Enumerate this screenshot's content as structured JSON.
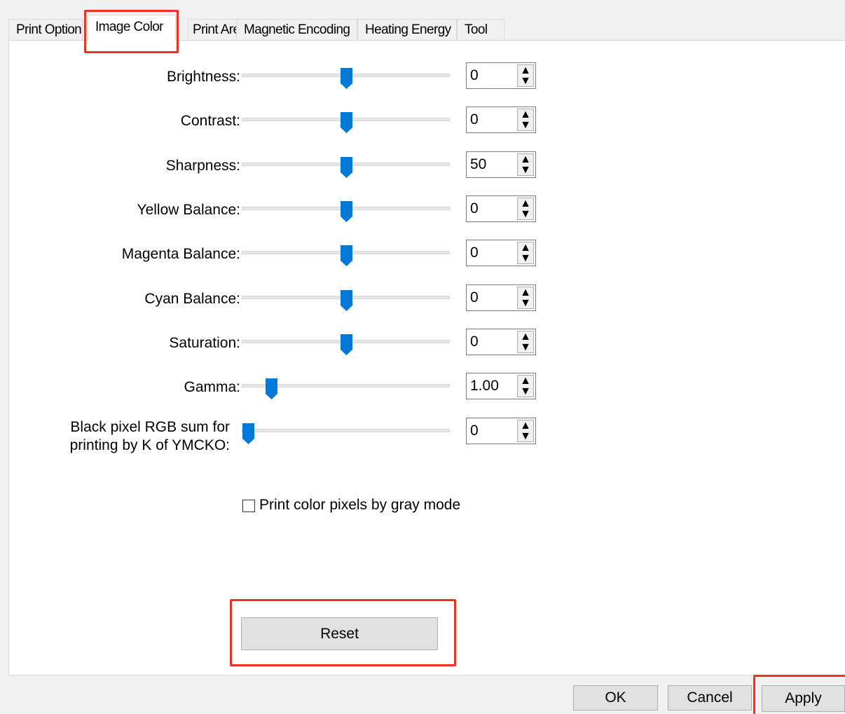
{
  "tabs": [
    {
      "label": "Print Option"
    },
    {
      "label": "Image Color"
    },
    {
      "label": "Print Area"
    },
    {
      "label": "Magnetic Encoding"
    },
    {
      "label": "Heating Energy"
    },
    {
      "label": "Tool"
    }
  ],
  "active_tab": "Image Color",
  "sliders": [
    {
      "label": "Brightness:",
      "value": "0",
      "position": 0.5
    },
    {
      "label": "Contrast:",
      "value": "0",
      "position": 0.5
    },
    {
      "label": "Sharpness:",
      "value": "50",
      "position": 0.5
    },
    {
      "label": "Yellow Balance:",
      "value": "0",
      "position": 0.5
    },
    {
      "label": "Magenta Balance:",
      "value": "0",
      "position": 0.5
    },
    {
      "label": "Cyan Balance:",
      "value": "0",
      "position": 0.5
    },
    {
      "label": "Saturation:",
      "value": "0",
      "position": 0.5
    },
    {
      "label": "Gamma:",
      "value": "1.00",
      "position": 0.12
    },
    {
      "label_line1": "Black pixel RGB sum for",
      "label_line2": "printing by K of YMCKO:",
      "value": "0",
      "position": 0.0
    }
  ],
  "gray_mode": {
    "label": "Print color pixels by gray mode",
    "checked": false
  },
  "buttons": {
    "reset": "Reset",
    "ok": "OK",
    "cancel": "Cancel",
    "apply": "Apply"
  },
  "colors": {
    "thumb": "#0078d7",
    "highlight": "#ea3323"
  }
}
